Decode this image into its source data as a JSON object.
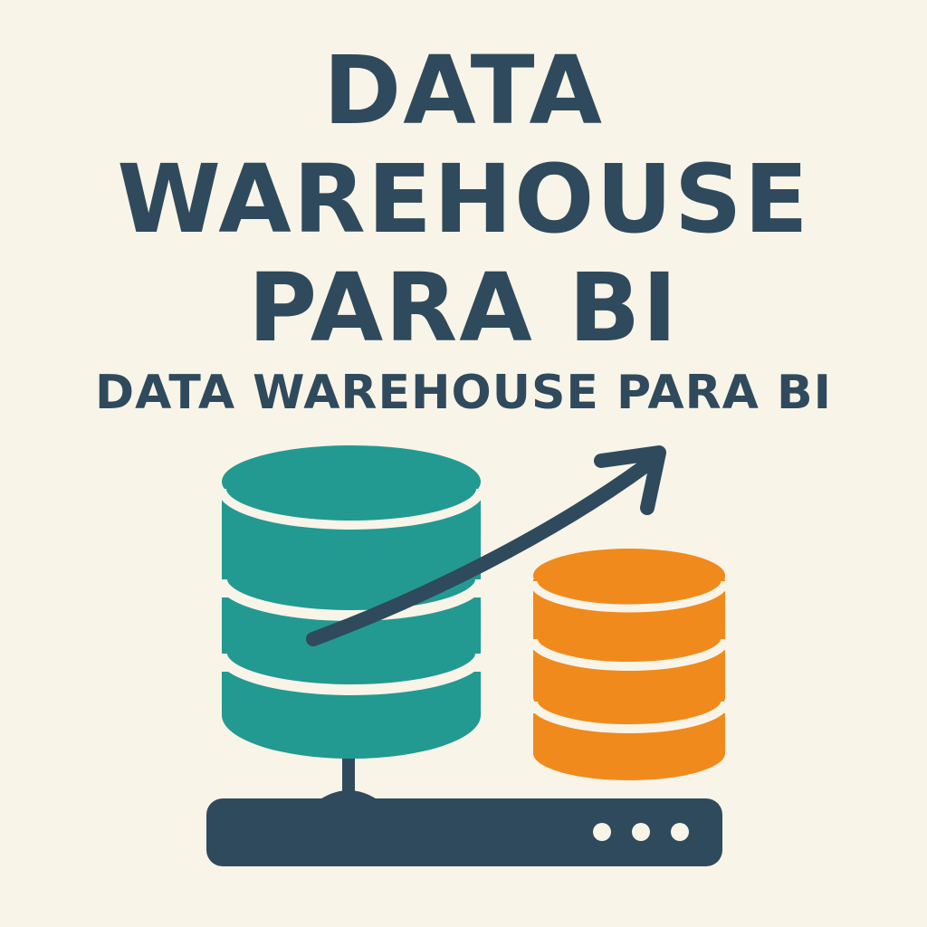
{
  "title": {
    "line1": "DATA",
    "line2": "WAREHOUSE",
    "line3": "PARA BI"
  },
  "subtitle": "DATA WAREHOUSE PARA BI",
  "colors": {
    "background": "#F9F4E8",
    "text": "#2F4A5C",
    "teal": "#229A91",
    "orange": "#F08A1C",
    "dark": "#2F4A5C",
    "band": "#F9F4E8"
  },
  "icons": {
    "large_database": "database-icon",
    "small_database": "database-icon",
    "arrow": "trend-up-arrow-icon",
    "server": "server-icon"
  }
}
